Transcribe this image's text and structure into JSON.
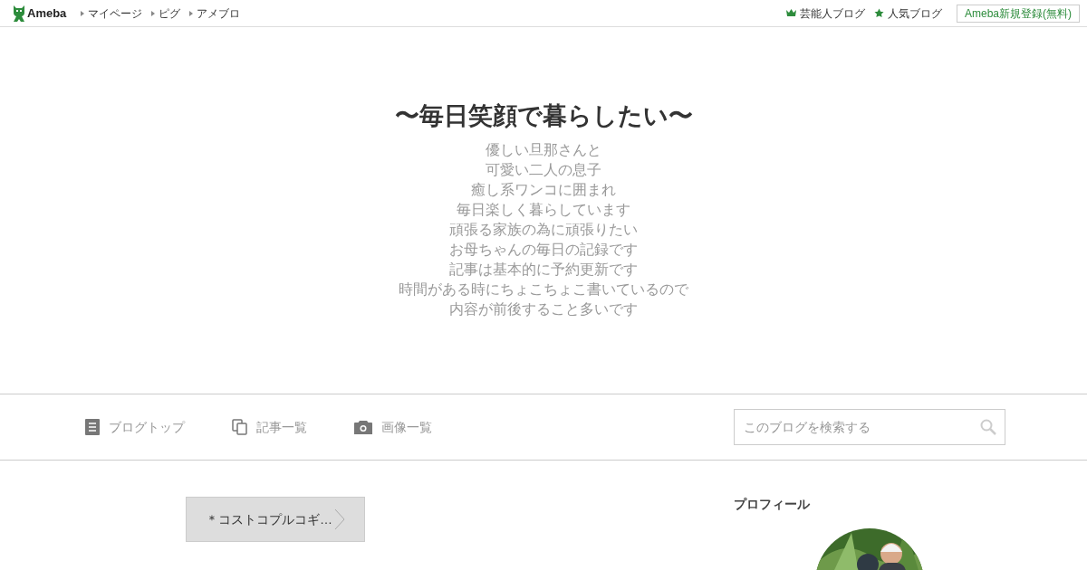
{
  "header": {
    "logo": "Ameba",
    "links": [
      "マイページ",
      "ピグ",
      "アメブロ"
    ],
    "right_links": [
      {
        "kind": "crown",
        "label": "芸能人ブログ"
      },
      {
        "kind": "star",
        "label": "人気ブログ"
      }
    ],
    "signup_button": "Ameba新規登録(無料)"
  },
  "blog": {
    "title": "〜毎日笑顔で暮らしたい〜",
    "description": [
      "優しい旦那さんと",
      "可愛い二人の息子",
      "癒し系ワンコに囲まれ",
      "毎日楽しく暮らしています",
      "頑張る家族の為に頑張りたい",
      "お母ちゃんの毎日の記録です",
      "記事は基本的に予約更新です",
      "時間がある時にちょこちょこ書いているので",
      "内容が前後すること多いです"
    ]
  },
  "nav": {
    "tabs": [
      {
        "kind": "top",
        "label": "ブログトップ"
      },
      {
        "kind": "entries",
        "label": "記事一覧"
      },
      {
        "kind": "images",
        "label": "画像一覧"
      }
    ],
    "search": {
      "placeholder": "このブログを検索する"
    }
  },
  "content": {
    "next_entry": "＊コストコプルコギ…"
  },
  "sidebar": {
    "profile_heading": "プロフィール"
  }
}
